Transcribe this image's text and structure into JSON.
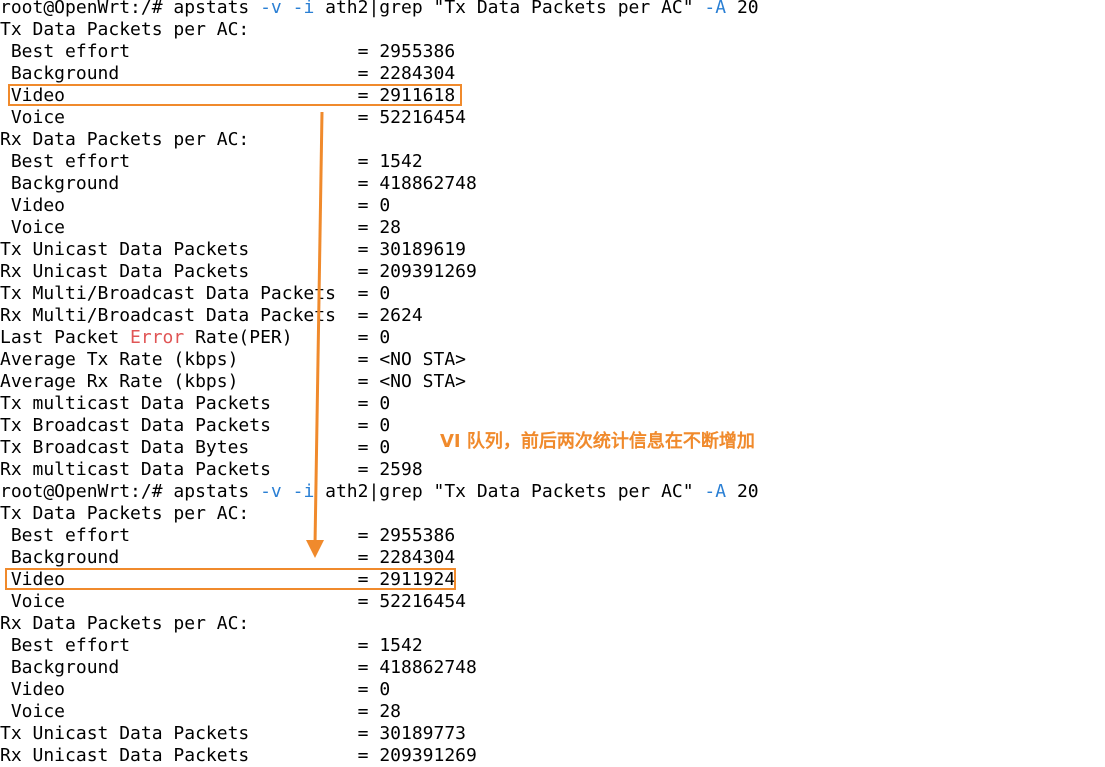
{
  "terminal": {
    "lines": [
      {
        "type": "prompt",
        "prompt": "root@OpenWrt:/# ",
        "cmd1": "apstats ",
        "flag1": "-v -i",
        "cmd2": " ath2|grep \"Tx Data Packets per AC\" ",
        "flag2": "-A",
        "cmd3": " 20"
      },
      {
        "type": "heading",
        "text": "Tx Data Packets per AC:"
      },
      {
        "type": "kv",
        "label": " Best effort",
        "value": "2955386"
      },
      {
        "type": "kv",
        "label": " Background",
        "value": "2284304"
      },
      {
        "type": "kv",
        "label": " Video",
        "value": "2911618"
      },
      {
        "type": "kv",
        "label": " Voice",
        "value": "52216454"
      },
      {
        "type": "heading",
        "text": "Rx Data Packets per AC:"
      },
      {
        "type": "kv",
        "label": " Best effort",
        "value": "1542"
      },
      {
        "type": "kv",
        "label": " Background",
        "value": "418862748"
      },
      {
        "type": "kv",
        "label": " Video",
        "value": "0"
      },
      {
        "type": "kv",
        "label": " Voice",
        "value": "28"
      },
      {
        "type": "kv",
        "label": "Tx Unicast Data Packets",
        "value": "30189619"
      },
      {
        "type": "kv",
        "label": "Rx Unicast Data Packets",
        "value": "209391269"
      },
      {
        "type": "kv",
        "label": "Tx Multi/Broadcast Data Packets",
        "value": "0"
      },
      {
        "type": "kv",
        "label": "Rx Multi/Broadcast Data Packets",
        "value": "2624"
      },
      {
        "type": "kv-error",
        "pre": "Last Packet ",
        "err": "Error",
        "post": " Rate(PER)",
        "value": "0"
      },
      {
        "type": "kv",
        "label": "Average Tx Rate (kbps)",
        "value": "<NO STA>"
      },
      {
        "type": "kv",
        "label": "Average Rx Rate (kbps)",
        "value": "<NO STA>"
      },
      {
        "type": "kv",
        "label": "Tx multicast Data Packets",
        "value": "0"
      },
      {
        "type": "kv",
        "label": "Tx Broadcast Data Packets",
        "value": "0"
      },
      {
        "type": "kv",
        "label": "Tx Broadcast Data Bytes",
        "value": "0"
      },
      {
        "type": "kv",
        "label": "Rx multicast Data Packets",
        "value": "2598"
      },
      {
        "type": "prompt",
        "prompt": "root@OpenWrt:/# ",
        "cmd1": "apstats ",
        "flag1": "-v -i",
        "cmd2": " ath2|grep \"Tx Data Packets per AC\" ",
        "flag2": "-A",
        "cmd3": " 20"
      },
      {
        "type": "heading",
        "text": "Tx Data Packets per AC:"
      },
      {
        "type": "kv",
        "label": " Best effort",
        "value": "2955386"
      },
      {
        "type": "kv",
        "label": " Background",
        "value": "2284304"
      },
      {
        "type": "kv",
        "label": " Video",
        "value": "2911924"
      },
      {
        "type": "kv",
        "label": " Voice",
        "value": "52216454"
      },
      {
        "type": "heading",
        "text": "Rx Data Packets per AC:"
      },
      {
        "type": "kv",
        "label": " Best effort",
        "value": "1542"
      },
      {
        "type": "kv",
        "label": " Background",
        "value": "418862748"
      },
      {
        "type": "kv",
        "label": " Video",
        "value": "0"
      },
      {
        "type": "kv",
        "label": " Voice",
        "value": "28"
      },
      {
        "type": "kv",
        "label": "Tx Unicast Data Packets",
        "value": "30189773"
      },
      {
        "type": "kv",
        "label": "Rx Unicast Data Packets",
        "value": "209391269"
      }
    ]
  },
  "separator": " = ",
  "annotation": {
    "text": "VI 队列，前后两次统计信息在不断增加"
  },
  "colors": {
    "accent": "#f08a2c",
    "flag": "#2a7fd4",
    "error_word": "#e05555",
    "text": "#000000",
    "background": "#ffffff"
  }
}
